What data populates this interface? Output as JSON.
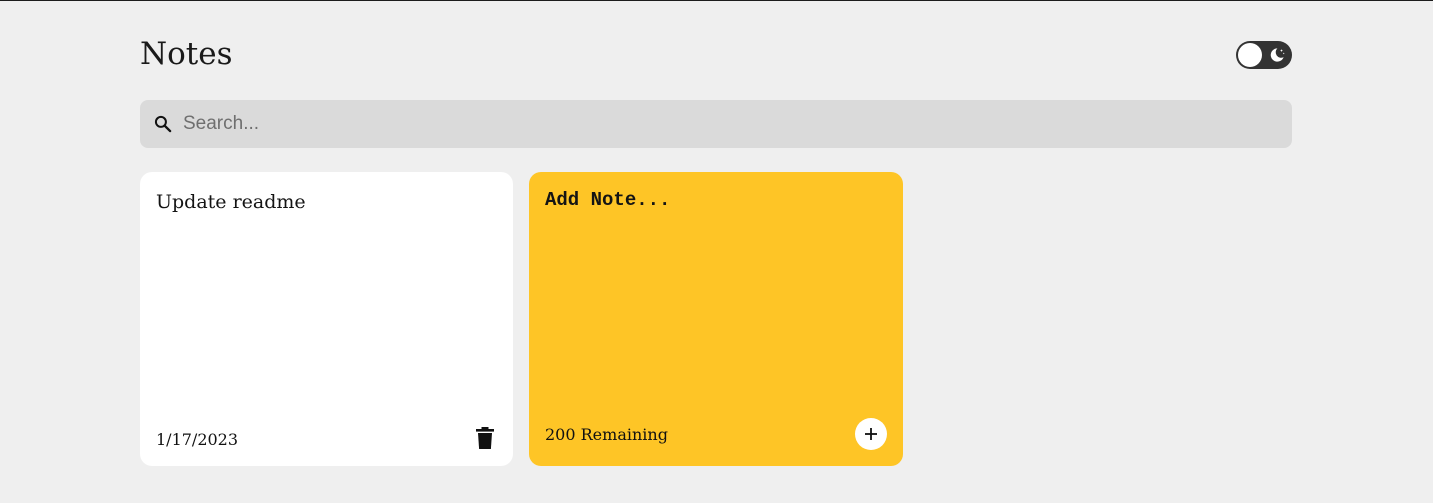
{
  "app": {
    "title": "Notes"
  },
  "theme_toggle": {
    "icon": "moon-icon",
    "knob_color": "#ffffff",
    "track_color": "#333333"
  },
  "search": {
    "placeholder": "Search...",
    "value": "",
    "icon": "search-icon"
  },
  "notes": [
    {
      "text": "Update readme",
      "date": "1/17/2023",
      "delete_icon": "trash-icon",
      "background": "#ffffff"
    }
  ],
  "new_note": {
    "placeholder": "Add Note...",
    "value": "",
    "remaining_label": "200 Remaining",
    "save_icon": "plus-icon",
    "background": "#fec526"
  },
  "colors": {
    "page_background": "#efefef",
    "search_background": "#dadada",
    "accent": "#fec526"
  }
}
